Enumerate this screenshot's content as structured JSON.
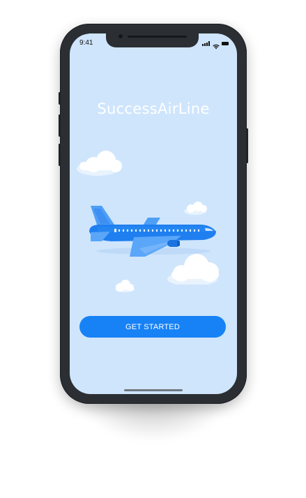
{
  "status_bar": {
    "time": "9:41",
    "icons": [
      "cellular-signal-icon",
      "wifi-icon",
      "battery-icon"
    ]
  },
  "app": {
    "title": "SuccessAirLine"
  },
  "illustration": {
    "subject": "airplane-illustration",
    "elements": [
      "cloud-icon",
      "airplane-icon",
      "cloud-icon",
      "cloud-icon",
      "cloud-icon"
    ]
  },
  "cta": {
    "label": "GET STARTED"
  },
  "colors": {
    "screen_background": "#cfe5fc",
    "accent": "#1782f5",
    "plane_body": "#1f7ff0",
    "plane_wing": "#5aa6f8",
    "device_frame": "#2b2f33",
    "title_text": "#ffffff"
  }
}
